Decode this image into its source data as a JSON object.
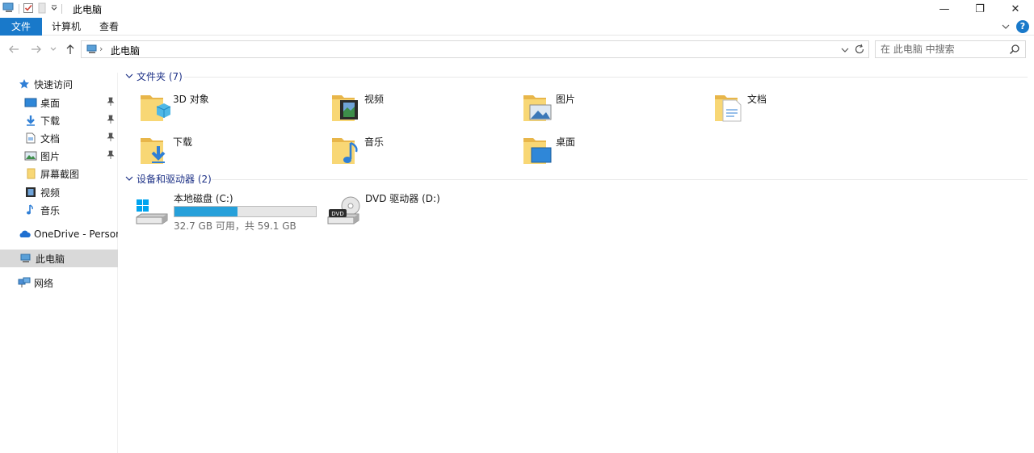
{
  "window": {
    "title": "此电脑",
    "minimize_glyph": "—",
    "restore_glyph": "❐",
    "close_glyph": "✕"
  },
  "ribbon": {
    "tabs": [
      {
        "label": "文件",
        "active": true
      },
      {
        "label": "计算机",
        "active": false
      },
      {
        "label": "查看",
        "active": false
      }
    ],
    "help_glyph": "?"
  },
  "nav": {
    "back_icon": "arrow-left-icon",
    "forward_icon": "arrow-right-icon",
    "up_icon": "arrow-up-icon",
    "breadcrumb": "此电脑",
    "search_placeholder": "在 此电脑 中搜索"
  },
  "sidebar": {
    "quick_access": "快速访问",
    "items": [
      {
        "label": "桌面",
        "icon": "desktop-icon",
        "pinned": true
      },
      {
        "label": "下载",
        "icon": "download-icon",
        "pinned": true
      },
      {
        "label": "文档",
        "icon": "document-icon",
        "pinned": true
      },
      {
        "label": "图片",
        "icon": "picture-icon",
        "pinned": true
      },
      {
        "label": "屏幕截图",
        "icon": "folder-icon",
        "pinned": false
      },
      {
        "label": "视频",
        "icon": "video-icon",
        "pinned": false
      },
      {
        "label": "音乐",
        "icon": "music-icon",
        "pinned": false
      }
    ],
    "onedrive": "OneDrive - Persona",
    "this_pc": "此电脑",
    "network": "网络"
  },
  "main": {
    "folders_header": "文件夹 (7)",
    "folders": [
      {
        "label": "3D 对象",
        "icon": "3d-objects-icon"
      },
      {
        "label": "视频",
        "icon": "video-folder-icon"
      },
      {
        "label": "图片",
        "icon": "pictures-folder-icon"
      },
      {
        "label": "文档",
        "icon": "documents-folder-icon"
      },
      {
        "label": "下载",
        "icon": "downloads-folder-icon"
      },
      {
        "label": "音乐",
        "icon": "music-folder-icon"
      },
      {
        "label": "桌面",
        "icon": "desktop-folder-icon"
      }
    ],
    "devices_header": "设备和驱动器 (2)",
    "drives": [
      {
        "label": "本地磁盘 (C:)",
        "detail": "32.7 GB 可用，共 59.1 GB",
        "used_fraction": 0.447,
        "icon": "windows-drive-icon"
      },
      {
        "label": "DVD 驱动器 (D:)",
        "icon": "dvd-drive-icon",
        "badge": "DVD"
      }
    ]
  },
  "colors": {
    "accent": "#1979ca",
    "header_text": "#1e3287",
    "drive_bar": "#26a0da",
    "folder_yellow": "#f8d775"
  }
}
